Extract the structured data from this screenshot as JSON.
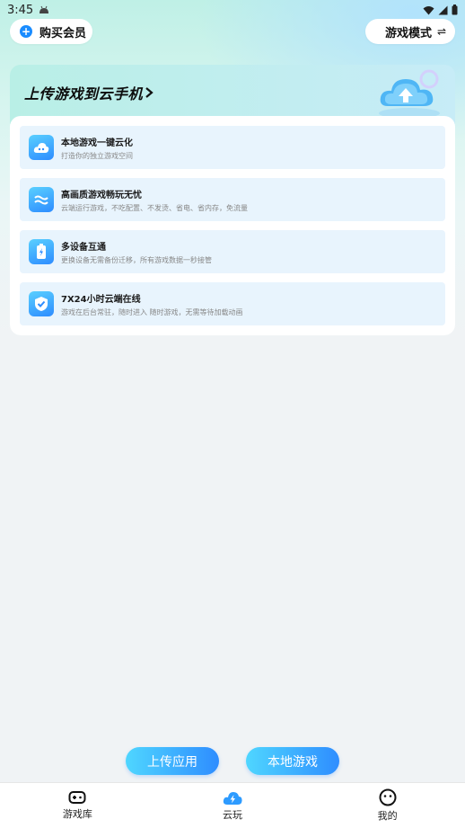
{
  "status_bar": {
    "time": "3:45"
  },
  "header": {
    "vip_label": "购买会员",
    "mode_label": "游戏模式",
    "mode_icon": "⇌"
  },
  "card": {
    "title": "上传游戏到云手机",
    "features": [
      {
        "title": "本地游戏一键云化",
        "subtitle": "打造你的独立游戏空间",
        "icon": "gamepad-cloud-icon"
      },
      {
        "title": "高画质游戏畅玩无忧",
        "subtitle": "云端运行游戏，不吃配置、不发烫、省电、省内存，免流量",
        "icon": "wave-icon"
      },
      {
        "title": "多设备互通",
        "subtitle": "更换设备无需备份迁移，所有游戏数据一秒接管",
        "icon": "battery-icon"
      },
      {
        "title": "7X24小时云端在线",
        "subtitle": "游戏在后台常驻，随时进入 随时游戏，无需等待加载动画",
        "icon": "shield-check-icon"
      }
    ]
  },
  "actions": {
    "upload_label": "上传应用",
    "local_label": "本地游戏"
  },
  "tabbar": {
    "items": [
      {
        "label": "游戏库",
        "icon": "gamepad-icon",
        "active": false
      },
      {
        "label": "云玩",
        "icon": "cloud-lightning-icon",
        "active": true
      },
      {
        "label": "我的",
        "icon": "smiley-icon",
        "active": false
      }
    ]
  },
  "colors": {
    "accent": "#1a8cff",
    "gradient_start": "#4fd6ff",
    "gradient_end": "#2e8dff"
  }
}
